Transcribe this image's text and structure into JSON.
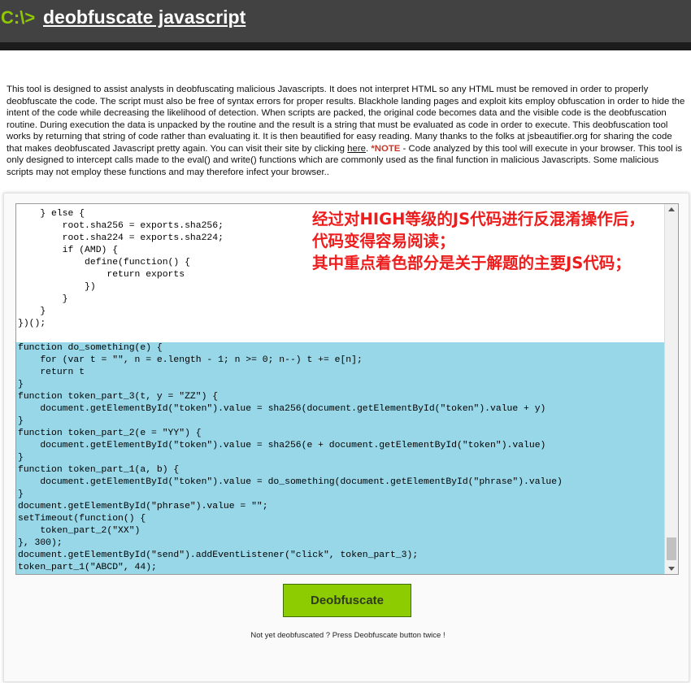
{
  "header": {
    "prompt": "C:\\>",
    "title": "deobfuscate javascript"
  },
  "description": {
    "text_main": "This tool is designed to assist analysts in deobfuscating malicious Javascripts. It does not interpret HTML so any HTML must be removed in order to properly deobfuscate the code. The script must also be free of syntax errors for proper results. Blackhole landing pages and exploit kits employ obfuscation in order to hide the intent of the code while decreasing the likelihood of detection. When scripts are packed, the original code becomes data and the visible code is the deobfuscation routine. During execution the data is unpacked by the routine and the result is a string that must be evaluated as code in order to execute. This deobfuscation tool works by returning that string of code rather than evaluating it. It is then beautified for easy reading. Many thanks to the folks at jsbeautifier.org for sharing the code that makes deobfuscated Javascript pretty again. You can visit their site by clicking ",
    "link_text": "here",
    "text_after_link": ". ",
    "note_label": "*NOTE",
    "text_note": " - Code analyzed by this tool will execute in your browser. This tool is only designed to intercept calls made to the eval() and write() functions which are commonly used as the final function in malicious Javascripts. Some malicious scripts may not employ these functions and may therefore infect your browser.."
  },
  "code": {
    "lines": [
      "    } else {",
      "        root.sha256 = exports.sha256;",
      "        root.sha224 = exports.sha224;",
      "        if (AMD) {",
      "            define(function() {",
      "                return exports",
      "            })",
      "        }",
      "    }",
      "})();",
      "",
      "function do_something(e) {",
      "    for (var t = \"\", n = e.length - 1; n >= 0; n--) t += e[n];",
      "    return t",
      "}",
      "function token_part_3(t, y = \"ZZ\") {",
      "    document.getElementById(\"token\").value = sha256(document.getElementById(\"token\").value + y)",
      "}",
      "function token_part_2(e = \"YY\") {",
      "    document.getElementById(\"token\").value = sha256(e + document.getElementById(\"token\").value)",
      "}",
      "function token_part_1(a, b) {",
      "    document.getElementById(\"token\").value = do_something(document.getElementById(\"phrase\").value)",
      "}",
      "document.getElementById(\"phrase\").value = \"\";",
      "setTimeout(function() {",
      "    token_part_2(\"XX\")",
      "}, 300);",
      "document.getElementById(\"send\").addEventListener(\"click\", token_part_3);",
      "token_part_1(\"ABCD\", 44);"
    ],
    "highlight_start": 11,
    "highlight_color": "#97d7e8"
  },
  "annotation": {
    "line1": "经过对HIGH等级的JS代码进行反混淆操作后，",
    "line2": "代码变得容易阅读；",
    "line3": "其中重点着色部分是关于解题的主要JS代码；"
  },
  "actions": {
    "deobfuscate_label": "Deobfuscate",
    "hint": "Not yet deobfuscated ? Press Deobfuscate button twice !"
  },
  "colors": {
    "header_bg": "#424242",
    "accent_green": "#8ccc00",
    "annotation_red": "#ee1d1d"
  }
}
